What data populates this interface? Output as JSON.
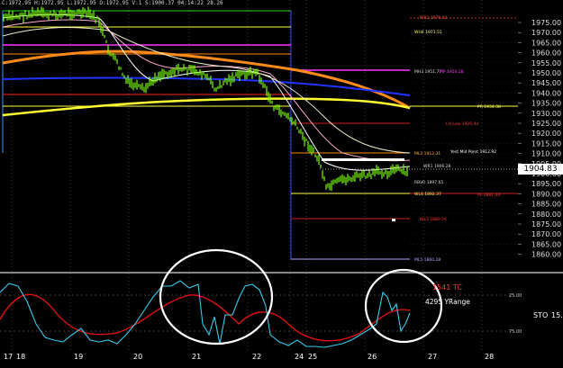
{
  "header": {
    "ohlc": "C:1972.95 H:1972.95 L:1972.95 O:1972.95 V:1 S:1900.37 04:14:22 28.26"
  },
  "price_axis": {
    "ticks": [
      "1975.00",
      "1970.00",
      "1965.00",
      "1960.00",
      "1955.00",
      "1950.00",
      "1945.00",
      "1940.00",
      "1935.00",
      "1930.00",
      "1925.00",
      "1920.00",
      "1915.00",
      "1910.00",
      "1905.00",
      "1900.00",
      "1895.00",
      "1890.00",
      "1885.00",
      "1880.00",
      "1875.00",
      "1870.00",
      "1865.00",
      "1860.00"
    ],
    "current_price": "1904.83"
  },
  "date_axis": {
    "labels": [
      "17",
      "18",
      "19",
      "20",
      "21",
      "22",
      "24",
      "25",
      "26",
      "27",
      "28"
    ]
  },
  "level_labels": {
    "wr1_top": "WR1 1976.02",
    "wh4": "WH4 1971.51",
    "mh3": "MH3 1951.77",
    "mp": "MP 1950.28",
    "pr": "PR 1934.38",
    "lh_low": "LH Low 1926.44",
    "ml3": "ML3 1912.31",
    "yest_mid": "Yest Mid Point 1912.92",
    "wr1_mid": "WR1 1906.28",
    "rbvr": "RBVR 1897.65",
    "wl4": "WL4 1892.37",
    "pl": "PL 1891.44",
    "wl3": "WL3 1880.56",
    "ml5": "ML5 1860.28"
  },
  "oscillator": {
    "label": "STO",
    "value_label": "15.",
    "level_25": "25.00",
    "level_75": "75.00",
    "ticks_text": "1541 TC",
    "range_text": "4295 YRange"
  },
  "colors": {
    "background": "#000000",
    "candle": "#7CFC00",
    "ma_orange": "#ff8c1a",
    "ma_yellow": "#ffff33",
    "ma_blue": "#2233ff",
    "stoch_fast": "#33ccee",
    "stoch_slow": "#dd1111",
    "magenta": "#ff33ff",
    "annotation": "#ffffff"
  }
}
